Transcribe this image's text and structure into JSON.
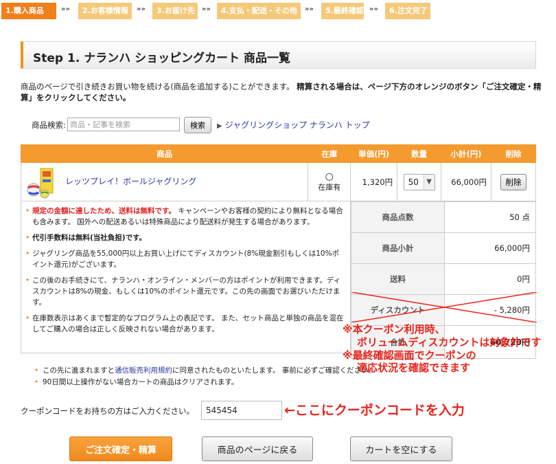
{
  "steps": [
    {
      "label": "1.購入商品",
      "state": "active"
    },
    {
      "label": "2.お客様情報",
      "state": "pending"
    },
    {
      "label": "3.お届け先",
      "state": "pending"
    },
    {
      "label": "4.支払・配送・その他",
      "state": "pending"
    },
    {
      "label": "5.最終確認",
      "state": "pending"
    },
    {
      "label": "6.注文完了",
      "state": "pending"
    }
  ],
  "step_separator": "»»",
  "page_title": "Step 1. ナランハ ショッピングカート 商品一覧",
  "intro": {
    "normal": "商品のページで引き続きお買い物を続ける(商品を追加する)ことができます。 ",
    "bold": "精算される場合は、ページ下方のオレンジのボタン「ご注文確定・精算」をクリックしてください。"
  },
  "search": {
    "label": "商品検索:",
    "placeholder": "商品・記事を検索",
    "button": "検索",
    "top_link": "ジャグリングショップ ナランハ トップ"
  },
  "cart": {
    "headers": {
      "product": "商品",
      "stock": "在庫",
      "unit_price": "単価(円)",
      "quantity": "数量",
      "subtotal": "小計(円)",
      "delete": "削除"
    },
    "items": [
      {
        "name": "レッツプレイ！ボールジャグリング",
        "stock_mark": "○",
        "stock_text": "在庫有",
        "unit_price": "1,320円",
        "quantity": "50",
        "subtotal": "66,000円",
        "delete_label": "削除"
      }
    ]
  },
  "notes": {
    "n1_red": "規定の金額に達したため、送料は無料です。",
    "n1_rest": " キャンペーンやお客様の契約により無料となる場合も含みます。 国外への配送あるいは特殊商品により配送料が発生する場合があります。",
    "n2": "代引手数料は無料(当社負担)です。",
    "n3": "ジャグリング商品を55,000円以上お買い上げにてディスカウント(8%現金割引もしくは10%ポイント還元)がございます。",
    "n4": "この後のお手続きにて、ナランハ・オンライン・メンバーの方はポイントが利用できます。ディスカウントは8%の現金、もしくは10%のポイント還元です。この先の画面でお選びいただけます。",
    "n5": "在庫数表示はあくまで暫定的なプログラム上の表記です。 また、セット商品と単独の商品を混在してご購入の場合は正しく反映されない場合があります。"
  },
  "summary": {
    "count_label": "商品点数",
    "count_value": "50 点",
    "subtotal_label": "商品小計",
    "subtotal_value": "66,000円",
    "shipping_label": "送料",
    "shipping_value": "0円",
    "discount_label": "ディスカウント",
    "discount_value": "- 5,280円",
    "total_label": "合計",
    "total_value": "60,720円"
  },
  "annotations": {
    "line1": "※本クーポン利用時、",
    "line2": "ボリュームディスカウントは対象外です",
    "line3": "※最終確認画面でクーポンの",
    "line4": "適応状況を確認できます",
    "coupon_hint": "←ここにクーポンコードを入力"
  },
  "terms": {
    "t1_link": "通信販売利用規約",
    "t1_pre": "この先に進まれますと",
    "t1_post": "に同意されたものといたします。 事前に必ずご確認ください。",
    "t2": "90日間以上操作がない場合カートの商品はクリアされます。"
  },
  "coupon": {
    "label": "クーポンコードをお持ちの方はご入力ください。",
    "value": "545454"
  },
  "buttons": {
    "checkout": "ご注文確定・精算",
    "back": "商品のページに戻る",
    "empty": "カートを空にする"
  },
  "colors": {
    "accent_orange": "#f07f1c",
    "header_orange": "#f59a2f",
    "pending_step": "#f5c97a",
    "annotation_red": "#e8231b",
    "link_blue": "#2a3a9a"
  }
}
